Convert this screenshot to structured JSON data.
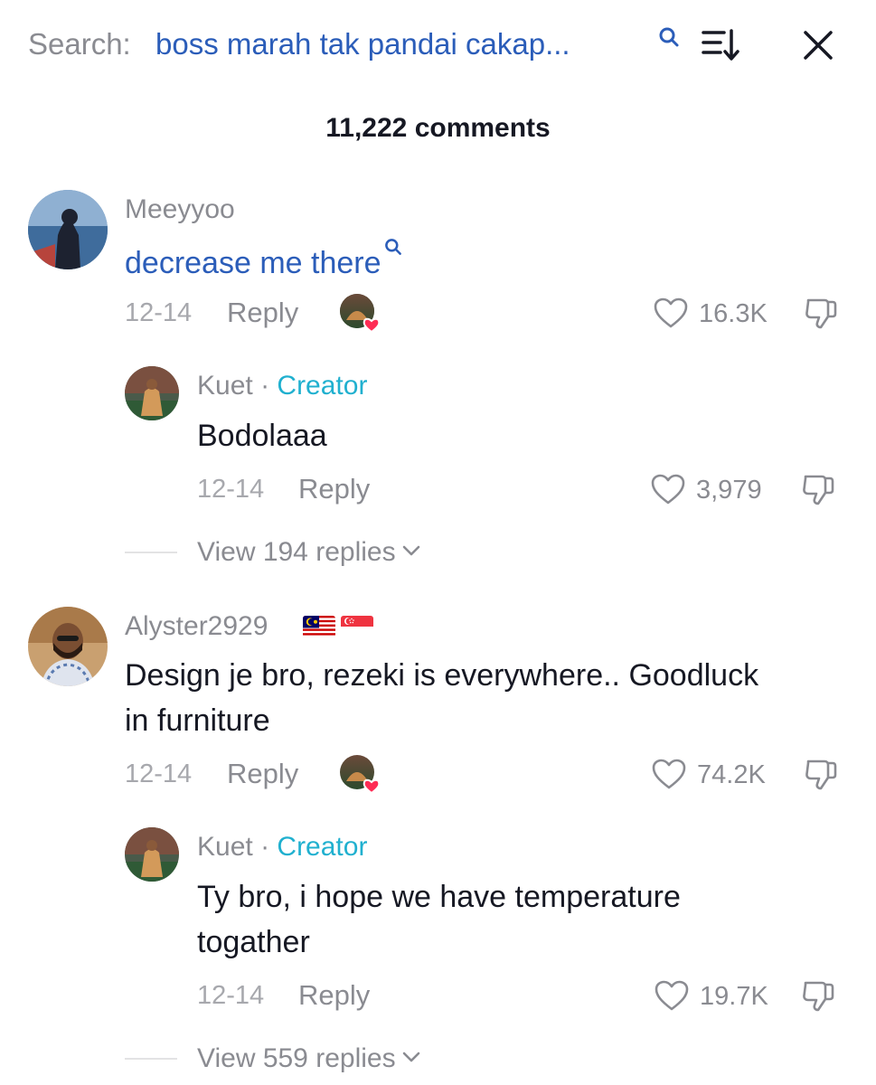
{
  "header": {
    "search_prefix": "Search:",
    "search_query": "boss marah tak pandai cakap...",
    "icons": [
      "search-icon",
      "sort-icon",
      "close-icon"
    ]
  },
  "comment_count": "11,222 comments",
  "colors": {
    "link": "#2b5db9",
    "creator": "#20b0cf",
    "muted": "#8a8b91",
    "heart_liked": "#fe2c55"
  },
  "comments": [
    {
      "username": "Meeyyoo",
      "text": "decrease me there",
      "date": "12-14",
      "reply_label": "Reply",
      "likes": "16.3K",
      "creator_liked": true,
      "replies": [
        {
          "username": "Kuet",
          "separator": "·",
          "tag": "Creator",
          "text": "Bodolaaa",
          "date": "12-14",
          "reply_label": "Reply",
          "likes": "3,979"
        }
      ],
      "view_replies": "View 194 replies"
    },
    {
      "username": "Alyster2929",
      "flags": [
        "malaysia-flag",
        "singapore-flag"
      ],
      "text_line1": "Design je bro, rezeki is everywhere.. Goodluck",
      "text_line2": "in furniture",
      "date": "12-14",
      "reply_label": "Reply",
      "likes": "74.2K",
      "creator_liked": true,
      "replies": [
        {
          "username": "Kuet",
          "separator": "·",
          "tag": "Creator",
          "text_line1": "Ty bro, i hope we have temperature",
          "text_line2": "togather",
          "date": "12-14",
          "reply_label": "Reply",
          "likes": "19.7K"
        }
      ],
      "view_replies": "View 559 replies"
    }
  ]
}
